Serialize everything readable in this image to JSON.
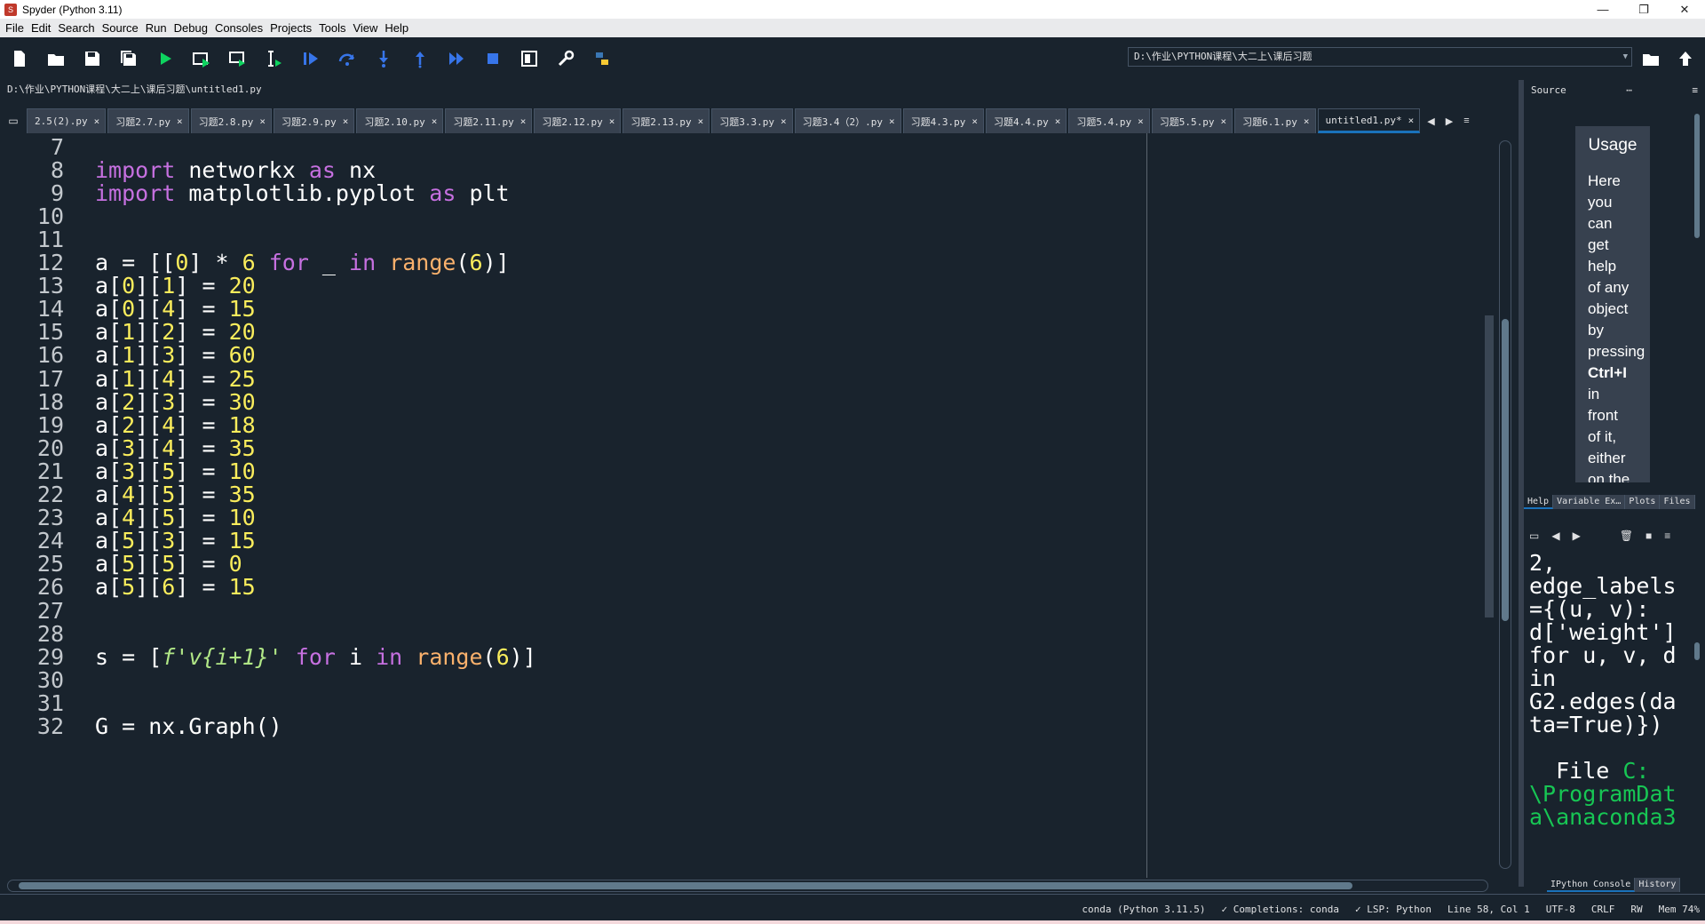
{
  "window": {
    "title": "Spyder (Python 3.11)",
    "minimize": "—",
    "maximize": "❐",
    "close": "✕"
  },
  "menu": [
    "File",
    "Edit",
    "Search",
    "Source",
    "Run",
    "Debug",
    "Consoles",
    "Projects",
    "Tools",
    "View",
    "Help"
  ],
  "toolbar": {
    "icons": [
      "new-file-icon",
      "open-file-icon",
      "save-icon",
      "save-all-icon",
      "run-icon",
      "run-cell-icon",
      "run-cell-advance-icon",
      "run-selection-icon",
      "debug-icon",
      "step-icon",
      "step-into-icon",
      "step-return-icon",
      "continue-icon",
      "stop-icon",
      "maximize-pane-icon",
      "preferences-icon",
      "python-path-icon"
    ],
    "working_dir": "D:\\作业\\PYTHON课程\\大二上\\课后习题"
  },
  "editor": {
    "filepath": "D:\\作业\\PYTHON课程\\大二上\\课后习题\\untitled1.py",
    "tabs": [
      {
        "label": "2.5(2).py",
        "active": false
      },
      {
        "label": "习题2.7.py",
        "active": false
      },
      {
        "label": "习题2.8.py",
        "active": false
      },
      {
        "label": "习题2.9.py",
        "active": false
      },
      {
        "label": "习题2.10.py",
        "active": false
      },
      {
        "label": "习题2.11.py",
        "active": false
      },
      {
        "label": "习题2.12.py",
        "active": false
      },
      {
        "label": "习题2.13.py",
        "active": false
      },
      {
        "label": "习题3.3.py",
        "active": false
      },
      {
        "label": "习题3.4（2）.py",
        "active": false
      },
      {
        "label": "习题4.3.py",
        "active": false
      },
      {
        "label": "习题4.4.py",
        "active": false
      },
      {
        "label": "习题5.4.py",
        "active": false
      },
      {
        "label": "习题5.5.py",
        "active": false
      },
      {
        "label": "习题6.1.py",
        "active": false
      },
      {
        "label": "untitled1.py*",
        "active": true
      }
    ],
    "lines": [
      {
        "n": "7",
        "tokens": []
      },
      {
        "n": "8",
        "tokens": [
          [
            "kw",
            "import"
          ],
          [
            "t",
            " networkx "
          ],
          [
            "kw",
            "as"
          ],
          [
            "t",
            " nx"
          ]
        ]
      },
      {
        "n": "9",
        "tokens": [
          [
            "kw",
            "import"
          ],
          [
            "t",
            " matplotlib.pyplot "
          ],
          [
            "kw",
            "as"
          ],
          [
            "t",
            " plt"
          ]
        ]
      },
      {
        "n": "10",
        "tokens": []
      },
      {
        "n": "11",
        "tokens": []
      },
      {
        "n": "12",
        "tokens": [
          [
            "t",
            "a = [["
          ],
          [
            "num",
            "0"
          ],
          [
            "t",
            "] * "
          ],
          [
            "num",
            "6"
          ],
          [
            "t",
            " "
          ],
          [
            "kw",
            "for"
          ],
          [
            "t",
            " _ "
          ],
          [
            "kw",
            "in"
          ],
          [
            "t",
            " "
          ],
          [
            "bi",
            "range"
          ],
          [
            "t",
            "("
          ],
          [
            "num",
            "6"
          ],
          [
            "t",
            ")]"
          ]
        ]
      },
      {
        "n": "13",
        "tokens": [
          [
            "t",
            "a["
          ],
          [
            "num",
            "0"
          ],
          [
            "t",
            "]["
          ],
          [
            "num",
            "1"
          ],
          [
            "t",
            "] = "
          ],
          [
            "num",
            "20"
          ]
        ]
      },
      {
        "n": "14",
        "tokens": [
          [
            "t",
            "a["
          ],
          [
            "num",
            "0"
          ],
          [
            "t",
            "]["
          ],
          [
            "num",
            "4"
          ],
          [
            "t",
            "] = "
          ],
          [
            "num",
            "15"
          ]
        ]
      },
      {
        "n": "15",
        "tokens": [
          [
            "t",
            "a["
          ],
          [
            "num",
            "1"
          ],
          [
            "t",
            "]["
          ],
          [
            "num",
            "2"
          ],
          [
            "t",
            "] = "
          ],
          [
            "num",
            "20"
          ]
        ]
      },
      {
        "n": "16",
        "tokens": [
          [
            "t",
            "a["
          ],
          [
            "num",
            "1"
          ],
          [
            "t",
            "]["
          ],
          [
            "num",
            "3"
          ],
          [
            "t",
            "] = "
          ],
          [
            "num",
            "60"
          ]
        ]
      },
      {
        "n": "17",
        "tokens": [
          [
            "t",
            "a["
          ],
          [
            "num",
            "1"
          ],
          [
            "t",
            "]["
          ],
          [
            "num",
            "4"
          ],
          [
            "t",
            "] = "
          ],
          [
            "num",
            "25"
          ]
        ]
      },
      {
        "n": "18",
        "tokens": [
          [
            "t",
            "a["
          ],
          [
            "num",
            "2"
          ],
          [
            "t",
            "]["
          ],
          [
            "num",
            "3"
          ],
          [
            "t",
            "] = "
          ],
          [
            "num",
            "30"
          ]
        ]
      },
      {
        "n": "19",
        "tokens": [
          [
            "t",
            "a["
          ],
          [
            "num",
            "2"
          ],
          [
            "t",
            "]["
          ],
          [
            "num",
            "4"
          ],
          [
            "t",
            "] = "
          ],
          [
            "num",
            "18"
          ]
        ]
      },
      {
        "n": "20",
        "tokens": [
          [
            "t",
            "a["
          ],
          [
            "num",
            "3"
          ],
          [
            "t",
            "]["
          ],
          [
            "num",
            "4"
          ],
          [
            "t",
            "] = "
          ],
          [
            "num",
            "35"
          ]
        ]
      },
      {
        "n": "21",
        "tokens": [
          [
            "t",
            "a["
          ],
          [
            "num",
            "3"
          ],
          [
            "t",
            "]["
          ],
          [
            "num",
            "5"
          ],
          [
            "t",
            "] = "
          ],
          [
            "num",
            "10"
          ]
        ]
      },
      {
        "n": "22",
        "tokens": [
          [
            "t",
            "a["
          ],
          [
            "num",
            "4"
          ],
          [
            "t",
            "]["
          ],
          [
            "num",
            "5"
          ],
          [
            "t",
            "] = "
          ],
          [
            "num",
            "35"
          ]
        ]
      },
      {
        "n": "23",
        "tokens": [
          [
            "t",
            "a["
          ],
          [
            "num",
            "4"
          ],
          [
            "t",
            "]["
          ],
          [
            "num",
            "5"
          ],
          [
            "t",
            "] = "
          ],
          [
            "num",
            "10"
          ]
        ]
      },
      {
        "n": "24",
        "tokens": [
          [
            "t",
            "a["
          ],
          [
            "num",
            "5"
          ],
          [
            "t",
            "]["
          ],
          [
            "num",
            "3"
          ],
          [
            "t",
            "] = "
          ],
          [
            "num",
            "15"
          ]
        ]
      },
      {
        "n": "25",
        "tokens": [
          [
            "t",
            "a["
          ],
          [
            "num",
            "5"
          ],
          [
            "t",
            "]["
          ],
          [
            "num",
            "5"
          ],
          [
            "t",
            "] = "
          ],
          [
            "num",
            "0"
          ]
        ]
      },
      {
        "n": "26",
        "tokens": [
          [
            "t",
            "a["
          ],
          [
            "num",
            "5"
          ],
          [
            "t",
            "]["
          ],
          [
            "num",
            "6"
          ],
          [
            "t",
            "] = "
          ],
          [
            "num",
            "15"
          ]
        ]
      },
      {
        "n": "27",
        "tokens": []
      },
      {
        "n": "28",
        "tokens": []
      },
      {
        "n": "29",
        "tokens": [
          [
            "t",
            "s = ["
          ],
          [
            "fstr",
            "f'v{i+1}'"
          ],
          [
            "t",
            " "
          ],
          [
            "kw",
            "for"
          ],
          [
            "t",
            " i "
          ],
          [
            "kw",
            "in"
          ],
          [
            "t",
            " "
          ],
          [
            "bi",
            "range"
          ],
          [
            "t",
            "("
          ],
          [
            "num",
            "6"
          ],
          [
            "t",
            ")]"
          ]
        ]
      },
      {
        "n": "30",
        "tokens": []
      },
      {
        "n": "31",
        "tokens": []
      },
      {
        "n": "32",
        "tokens": [
          [
            "t",
            "G = nx.Graph()"
          ]
        ]
      }
    ]
  },
  "help": {
    "header": "Source",
    "usage_title": "Usage",
    "usage_words": [
      "Here",
      "you",
      "can",
      "get",
      "help",
      "of any",
      "object",
      "by",
      "pressing",
      "Ctrl+I",
      "in",
      "front",
      "of it,",
      "either",
      "on the"
    ],
    "tabs": [
      {
        "label": "Help",
        "active": true
      },
      {
        "label": "Variable Ex…",
        "active": false
      },
      {
        "label": "Plots",
        "active": false
      },
      {
        "label": "Files",
        "active": false
      }
    ]
  },
  "console": {
    "lines": [
      {
        "text": "2,"
      },
      {
        "text": "edge_labels"
      },
      {
        "text": "={(u, v):"
      },
      {
        "text": "d['weight']"
      },
      {
        "text": "for u, v, d"
      },
      {
        "text": "in"
      },
      {
        "text": "G2.edges(da"
      },
      {
        "text": "ta=True)})"
      },
      {
        "text": ""
      },
      {
        "text": "  File ",
        "green": "C:"
      },
      {
        "text": "",
        "green": "\\ProgramDat"
      },
      {
        "text": "",
        "green": "a\\anaconda3"
      }
    ],
    "tabs": [
      {
        "label": "IPython Console",
        "active": true
      },
      {
        "label": "History",
        "active": false
      }
    ]
  },
  "status": {
    "env": "conda (Python 3.11.5)",
    "completions": "✓ Completions: conda",
    "lsp": "✓ LSP: Python",
    "position": "Line 58, Col 1",
    "encoding": "UTF-8",
    "eol": "CRLF",
    "rw": "RW",
    "mem": "Mem 74%"
  },
  "colors": {
    "background": "#19232d",
    "keyword": "#c670e0",
    "number": "#faed5c",
    "builtin": "#fab16c",
    "string": "#b0e686",
    "accent": "#1a72bb"
  }
}
